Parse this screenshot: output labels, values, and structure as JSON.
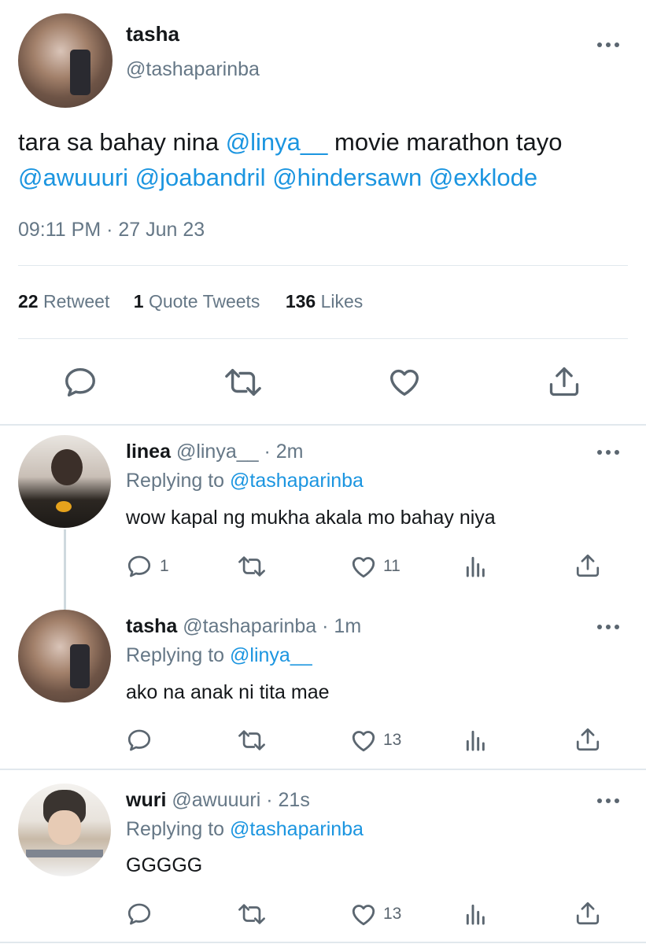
{
  "main_tweet": {
    "display_name": "tasha",
    "handle": "@tashaparinba",
    "text_plain_1": "tara sa bahay nina ",
    "mention_1": "@linya__",
    "text_plain_2": " movie marathon tayo",
    "mentions_line2": [
      "@awuuuri",
      "@joabandril",
      "@hindersawn",
      "@exklode"
    ],
    "time": "09:11 PM",
    "separator": "·",
    "date": "27 Jun 23",
    "stats": {
      "retweets_count": "22",
      "retweets_label": "Retweet",
      "quotes_count": "1",
      "quotes_label": "Quote Tweets",
      "likes_count": "136",
      "likes_label": "Likes"
    }
  },
  "replies": [
    {
      "display_name": "linea",
      "handle": "@linya__",
      "meta": "· 2m",
      "replying_label": "Replying to",
      "replying_to": "@tashaparinba",
      "text": "wow kapal ng mukha akala mo bahay niya",
      "reply_count": "1",
      "retweet_count": "",
      "like_count": "11"
    },
    {
      "display_name": "tasha",
      "handle": "@tashaparinba",
      "meta": "· 1m",
      "replying_label": "Replying to",
      "replying_to": "@linya__",
      "text": "ako na anak ni tita mae",
      "reply_count": "",
      "retweet_count": "",
      "like_count": "13"
    },
    {
      "display_name": "wuri",
      "handle": "@awuuuri",
      "meta": "· 21s",
      "replying_label": "Replying to",
      "replying_to": "@tashaparinba",
      "text": "GGGGG",
      "reply_count": "",
      "retweet_count": "",
      "like_count": "13"
    }
  ],
  "colors": {
    "link": "#1b95e0",
    "muted": "#657786",
    "divider": "#e1e8ed",
    "text": "#14171a"
  }
}
